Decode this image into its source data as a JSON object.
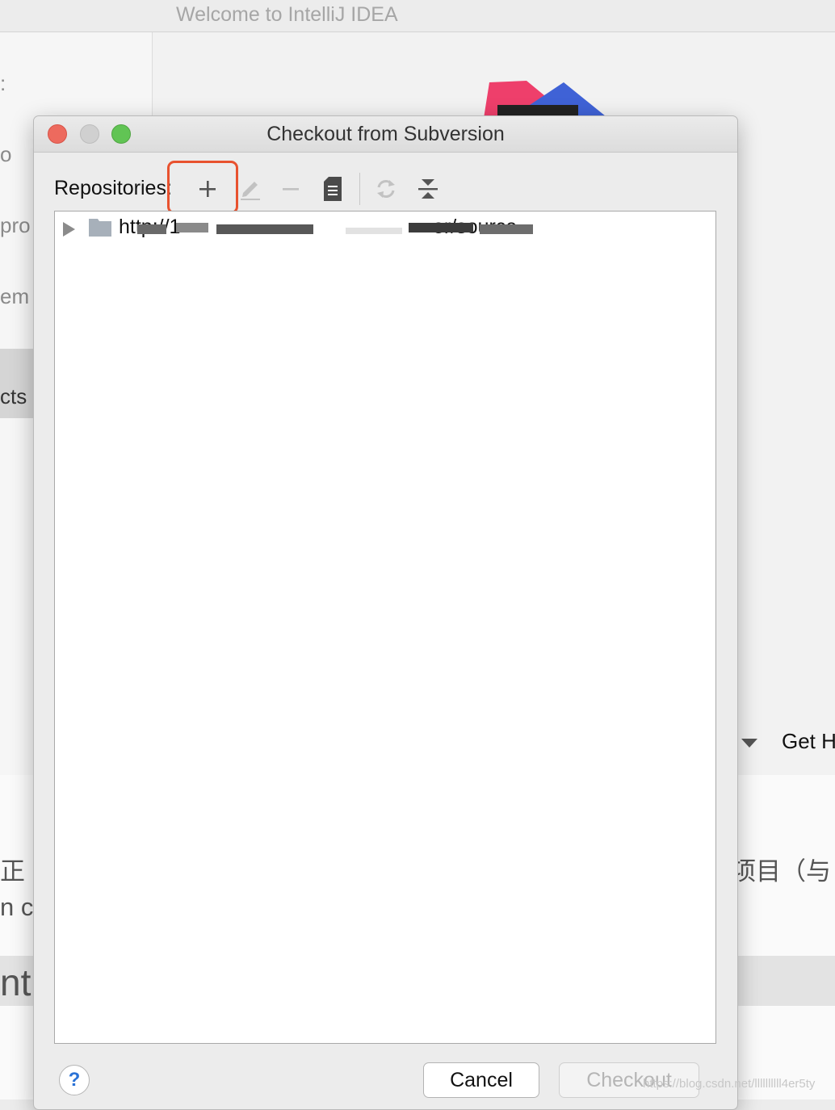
{
  "background": {
    "window_title": "Welcome to IntelliJ IDEA",
    "sidebar_fragments": [
      ":",
      "o",
      "pro",
      "em",
      "cts"
    ],
    "get_help": "Get H",
    "article_fragments": [
      "正",
      "项目（与",
      "n c",
      "nt"
    ]
  },
  "dialog": {
    "title": "Checkout from Subversion",
    "repositories_label": "Repositories:",
    "toolbar": {
      "add": "plus-icon",
      "edit": "pencil-icon",
      "remove": "minus-icon",
      "info": "document-icon",
      "refresh": "refresh-icon",
      "collapse": "collapse-all-icon"
    },
    "repositories": [
      {
        "url": "http://1                                             er/source",
        "icon": "folder-icon"
      }
    ],
    "buttons": {
      "help": "?",
      "cancel": "Cancel",
      "checkout": "Checkout"
    }
  },
  "watermark": "https://blog.csdn.net/llllllllll4er5ty",
  "colors": {
    "highlight": "#e8522f",
    "help_blue": "#2a72d6",
    "close": "#ed6a5e",
    "maximize": "#61c454"
  }
}
